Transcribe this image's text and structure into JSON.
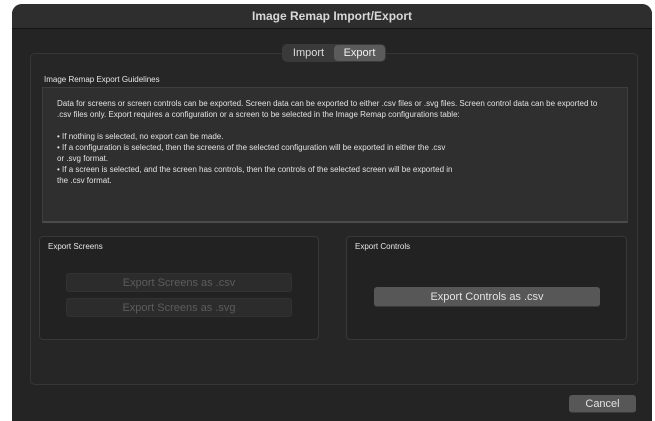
{
  "window": {
    "title": "Image Remap Import/Export"
  },
  "tabs": [
    {
      "label": "Import",
      "active": false
    },
    {
      "label": "Export",
      "active": true
    }
  ],
  "guidelines": {
    "title": "Image Remap Export Guidelines",
    "lines": [
      "Data for screens or screen controls can be exported. Screen data can be exported to either .csv files or .svg files. Screen control data can be exported to .csv files only. Export requires a configuration or a screen to be selected in the Image Remap configurations table:",
      "",
      "• If nothing is selected, no export can be made.",
      "• If a configuration is selected, then the screens of the selected configuration will be exported in either the .csv",
      "or .svg format.",
      "• If a screen is selected, and the screen has controls, then the controls of the selected screen will be exported in",
      "the .csv format."
    ]
  },
  "export_screens": {
    "title": "Export Screens",
    "csv_button": "Export Screens as .csv",
    "svg_button": "Export Screens as .svg",
    "enabled": false
  },
  "export_controls": {
    "title": "Export Controls",
    "csv_button": "Export Controls as .csv",
    "enabled": true
  },
  "footer": {
    "cancel_label": "Cancel"
  },
  "colors": {
    "window_bg": "#242424",
    "panel_bg": "#262626",
    "active_tab": "#5b5b5b",
    "button_bg": "#575757",
    "disabled_text": "#5c5c5c"
  }
}
